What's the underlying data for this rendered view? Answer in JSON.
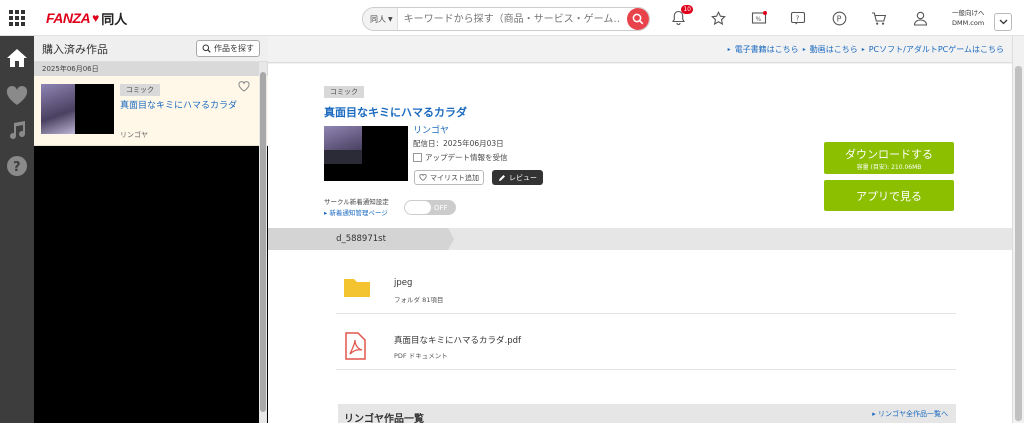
{
  "header": {
    "logo_brand": "FANZA",
    "logo_sub": "同人",
    "search_category": "同人",
    "search_placeholder": "キーワードから探す（商品・サービス・ゲーム…",
    "notification_count": "10",
    "lang_line1": "一般向けへ",
    "lang_line2": "DMM.com"
  },
  "panel": {
    "title": "購入済み作品",
    "find_button": "作品を探す",
    "date": "2025年06月06日",
    "items": [
      {
        "genre": "コミック",
        "title": "真面目なキミにハマるカラダ",
        "author": "リンゴヤ"
      }
    ]
  },
  "topbar": {
    "links": [
      "電子書籍はこちら",
      "動画はこちら",
      "PCソフト/アダルトPCゲームはこちら"
    ]
  },
  "detail": {
    "genre": "コミック",
    "title": "真面目なキミにハマるカラダ",
    "author": "リンゴヤ",
    "date": "配信日：2025年06月03日",
    "update_label": "アップデート情報を受信",
    "mylist_label": "マイリスト追加",
    "review_label": "レビュー",
    "circle_notify": "サークル新着通知設定",
    "notify_manage": "新着通知管理ページ",
    "toggle_state": "OFF",
    "download_label": "ダウンロードする",
    "download_size": "容量 (目安): 210.06MB",
    "app_label": "アプリで見る"
  },
  "files": {
    "path": "d_588971st",
    "items": [
      {
        "name": "jpeg",
        "meta": "フォルダ 81項目",
        "icon": "folder-icon"
      },
      {
        "name": "真面目なキミにハマるカラダ.pdf",
        "meta": "PDF ドキュメント",
        "icon": "pdf-icon"
      }
    ]
  },
  "section": {
    "title": "リンゴヤ作品一覧",
    "link": "リンゴヤ全作品一覧へ"
  },
  "colors": {
    "brand_red": "#e0001b",
    "link_blue": "#1a6ac0",
    "action_green": "#8bbf00",
    "rail": "#3d3d3d"
  }
}
